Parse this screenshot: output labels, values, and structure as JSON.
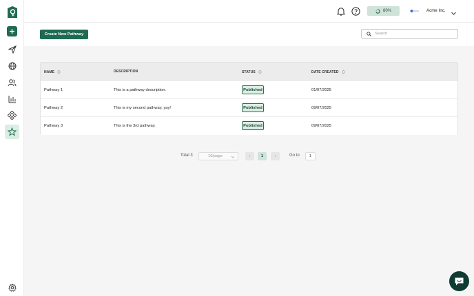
{
  "brand": {
    "accent": "#1d6b52",
    "dark": "#0f3b30",
    "badge_bg": "#dbeee4"
  },
  "sidebar": {
    "items": [
      {
        "icon": "logo-icon"
      },
      {
        "icon": "plus-icon"
      },
      {
        "icon": "send-icon"
      },
      {
        "icon": "globe-icon"
      },
      {
        "icon": "users-icon"
      },
      {
        "icon": "bar-chart-icon"
      },
      {
        "icon": "nodes-icon"
      },
      {
        "icon": "star-icon",
        "active": true
      },
      {
        "icon": "gear-icon"
      }
    ]
  },
  "header": {
    "progress_label": "80%",
    "progress_value": 0.8,
    "org_name": "Acme Inc."
  },
  "toolbar": {
    "create_label": "Create New Pathway",
    "search_placeholder": "Search"
  },
  "table": {
    "columns": [
      "NAME",
      "DESCRIPTION",
      "STATUS",
      "DATE CREATED"
    ],
    "rows": [
      {
        "name": "Pathway 1",
        "description": "This is a pathway description.",
        "status": "Published",
        "date": "01/07/2025"
      },
      {
        "name": "Pathway 2",
        "description": "This is my second pathway, yay!",
        "status": "Published",
        "date": "09/07/2025"
      },
      {
        "name": "Pathway 3",
        "description": "This is the 3rd pathway.",
        "status": "Published",
        "date": "09/07/2025"
      }
    ]
  },
  "pagination": {
    "total_label": "Total 3",
    "page_size": "10/page",
    "prev_label": "‹",
    "current_page": "1",
    "next_label": "›",
    "goto_label": "Go to",
    "goto_value": "1"
  }
}
